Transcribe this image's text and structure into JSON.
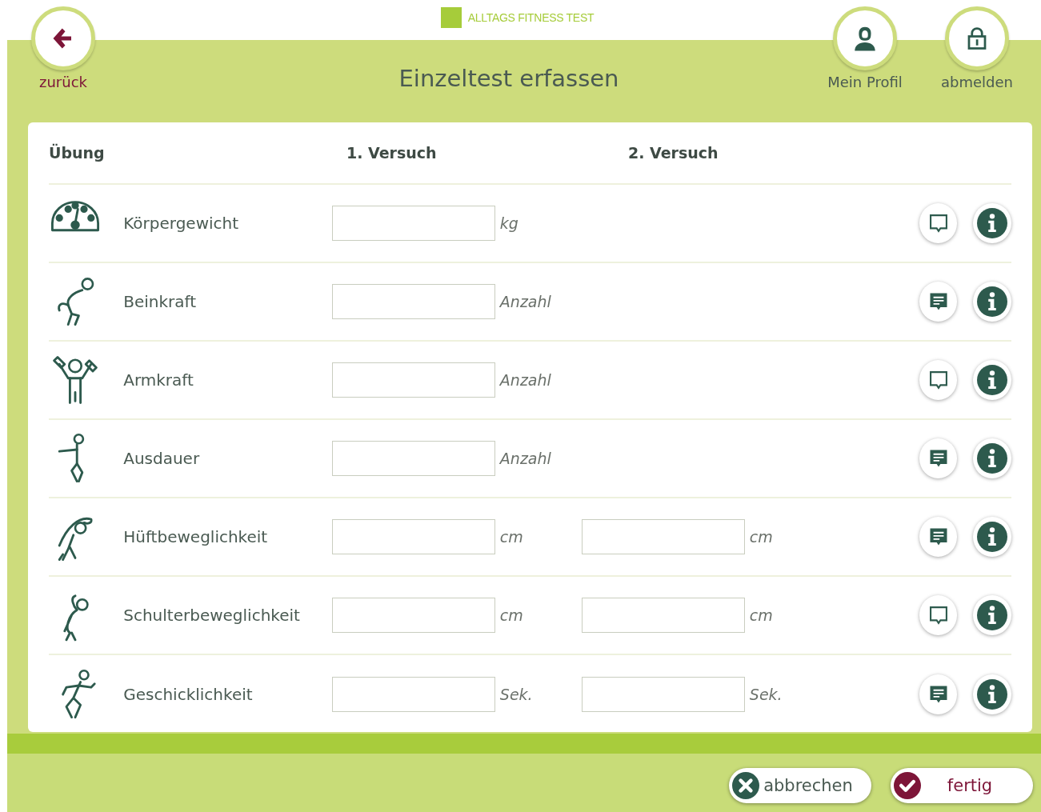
{
  "app_title": "ALLTAGS FITNESS TEST",
  "back": {
    "label": "zurück"
  },
  "page_title": "Einzeltest erfassen",
  "profile": {
    "label": "Mein Profil"
  },
  "logout": {
    "label": "abmelden"
  },
  "columns": [
    "Übung",
    "1. Versuch",
    "2. Versuch"
  ],
  "rows": [
    {
      "name": "Körpergewicht",
      "kind": "scale",
      "unit_1": "kg",
      "has_note": false
    },
    {
      "name": "Beinkraft",
      "kind": "squat",
      "unit_1": "Anzahl",
      "has_note": true
    },
    {
      "name": "Armkraft",
      "kind": "dumbbells",
      "unit_1": "Anzahl",
      "has_note": false
    },
    {
      "name": "Ausdauer",
      "kind": "march",
      "unit_1": "Anzahl",
      "has_note": true
    },
    {
      "name": "Hüftbeweglichkeit",
      "kind": "bend",
      "unit_1": "cm",
      "unit_2": "cm",
      "has_note": true
    },
    {
      "name": "Schulterbeweglichkeit",
      "kind": "stretch",
      "unit_1": "cm",
      "unit_2": "cm",
      "has_note": false
    },
    {
      "name": "Geschicklichkeit",
      "kind": "run",
      "unit_1": "Sek.",
      "unit_2": "Sek.",
      "has_note": true
    }
  ],
  "buttons": [
    {
      "label": "abbrechen",
      "kind": "cancel"
    },
    {
      "label": "fertig",
      "kind": "done"
    }
  ]
}
